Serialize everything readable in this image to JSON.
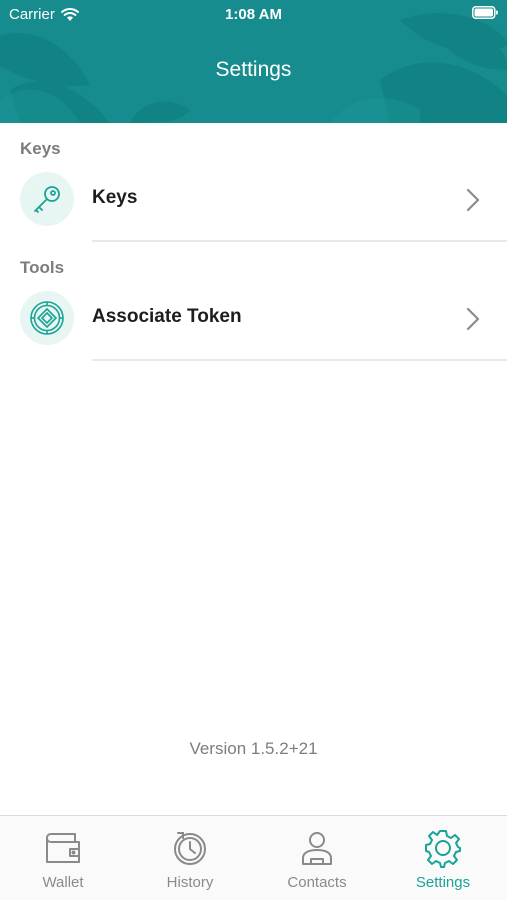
{
  "status_bar": {
    "carrier": "Carrier",
    "time": "1:08 AM"
  },
  "header": {
    "title": "Settings"
  },
  "sections": [
    {
      "title": "Keys",
      "items": [
        {
          "label": "Keys",
          "icon": "key-icon"
        }
      ]
    },
    {
      "title": "Tools",
      "items": [
        {
          "label": "Associate Token",
          "icon": "token-icon"
        }
      ]
    }
  ],
  "version": "Version 1.5.2+21",
  "tabs": [
    {
      "label": "Wallet",
      "icon": "wallet-icon",
      "active": false
    },
    {
      "label": "History",
      "icon": "history-icon",
      "active": false
    },
    {
      "label": "Contacts",
      "icon": "contacts-icon",
      "active": false
    },
    {
      "label": "Settings",
      "icon": "gear-icon",
      "active": true
    }
  ],
  "colors": {
    "header_teal": "#168c8e",
    "accent": "#1aa396",
    "icon_bg": "#e7f6f3"
  }
}
